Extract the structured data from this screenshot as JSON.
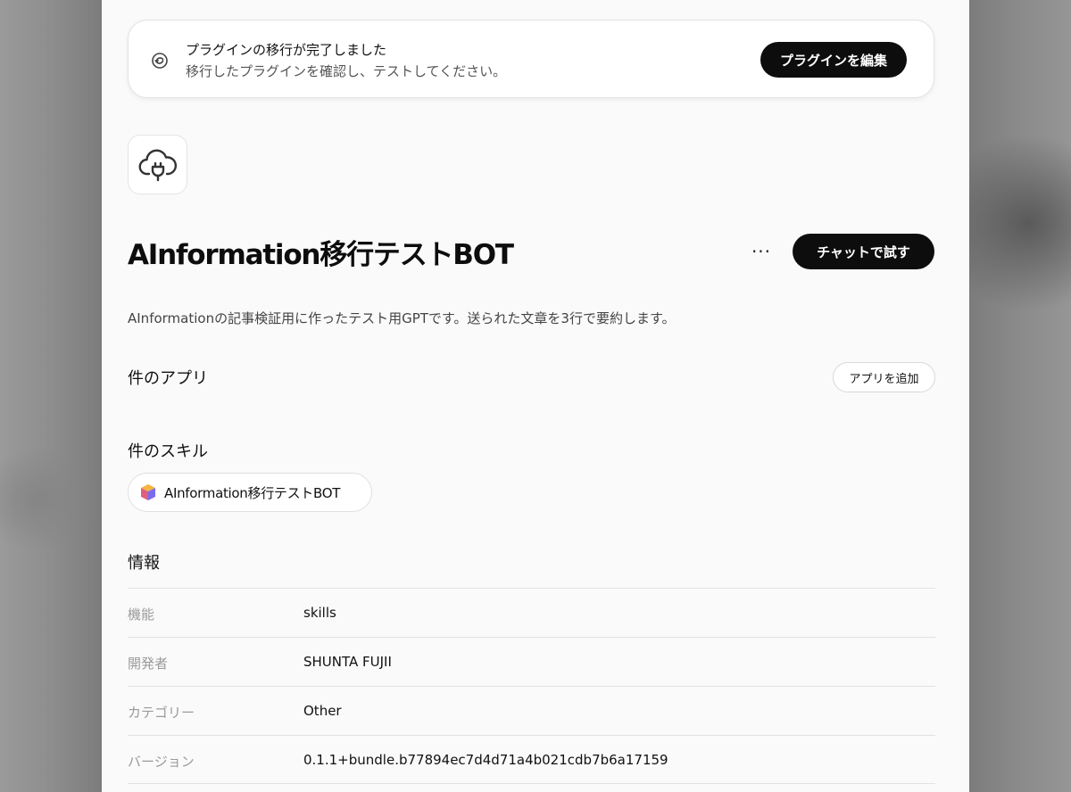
{
  "banner": {
    "title": "プラグインの移行が完了しました",
    "subtitle": "移行したプラグインを確認し、テストしてください。",
    "edit_button": "プラグインを編集",
    "icon": "migrate-refresh-icon"
  },
  "plugin": {
    "icon": "cloud-plug-icon",
    "title": "AInformation移行テストBOT",
    "more_label": "···",
    "try_button": "チャットで試す",
    "description": "AInformationの記事検証用に作ったテスト用GPTです。送られた文章を3行で要約します。"
  },
  "apps": {
    "heading": "件のアプリ",
    "add_button": "アプリを追加"
  },
  "skills": {
    "heading": "件のスキル",
    "items": [
      {
        "label": "AInformation移行テストBOT",
        "icon": "skill-cube-icon"
      }
    ]
  },
  "info": {
    "heading": "情報",
    "rows": [
      {
        "key": "機能",
        "value": "skills"
      },
      {
        "key": "開発者",
        "value": "SHUNTA FUJII"
      },
      {
        "key": "カテゴリー",
        "value": "Other"
      },
      {
        "key": "バージョン",
        "value": "0.1.1+bundle.b77894ec7d4d71a4b021cdb7b6a17159"
      }
    ]
  }
}
